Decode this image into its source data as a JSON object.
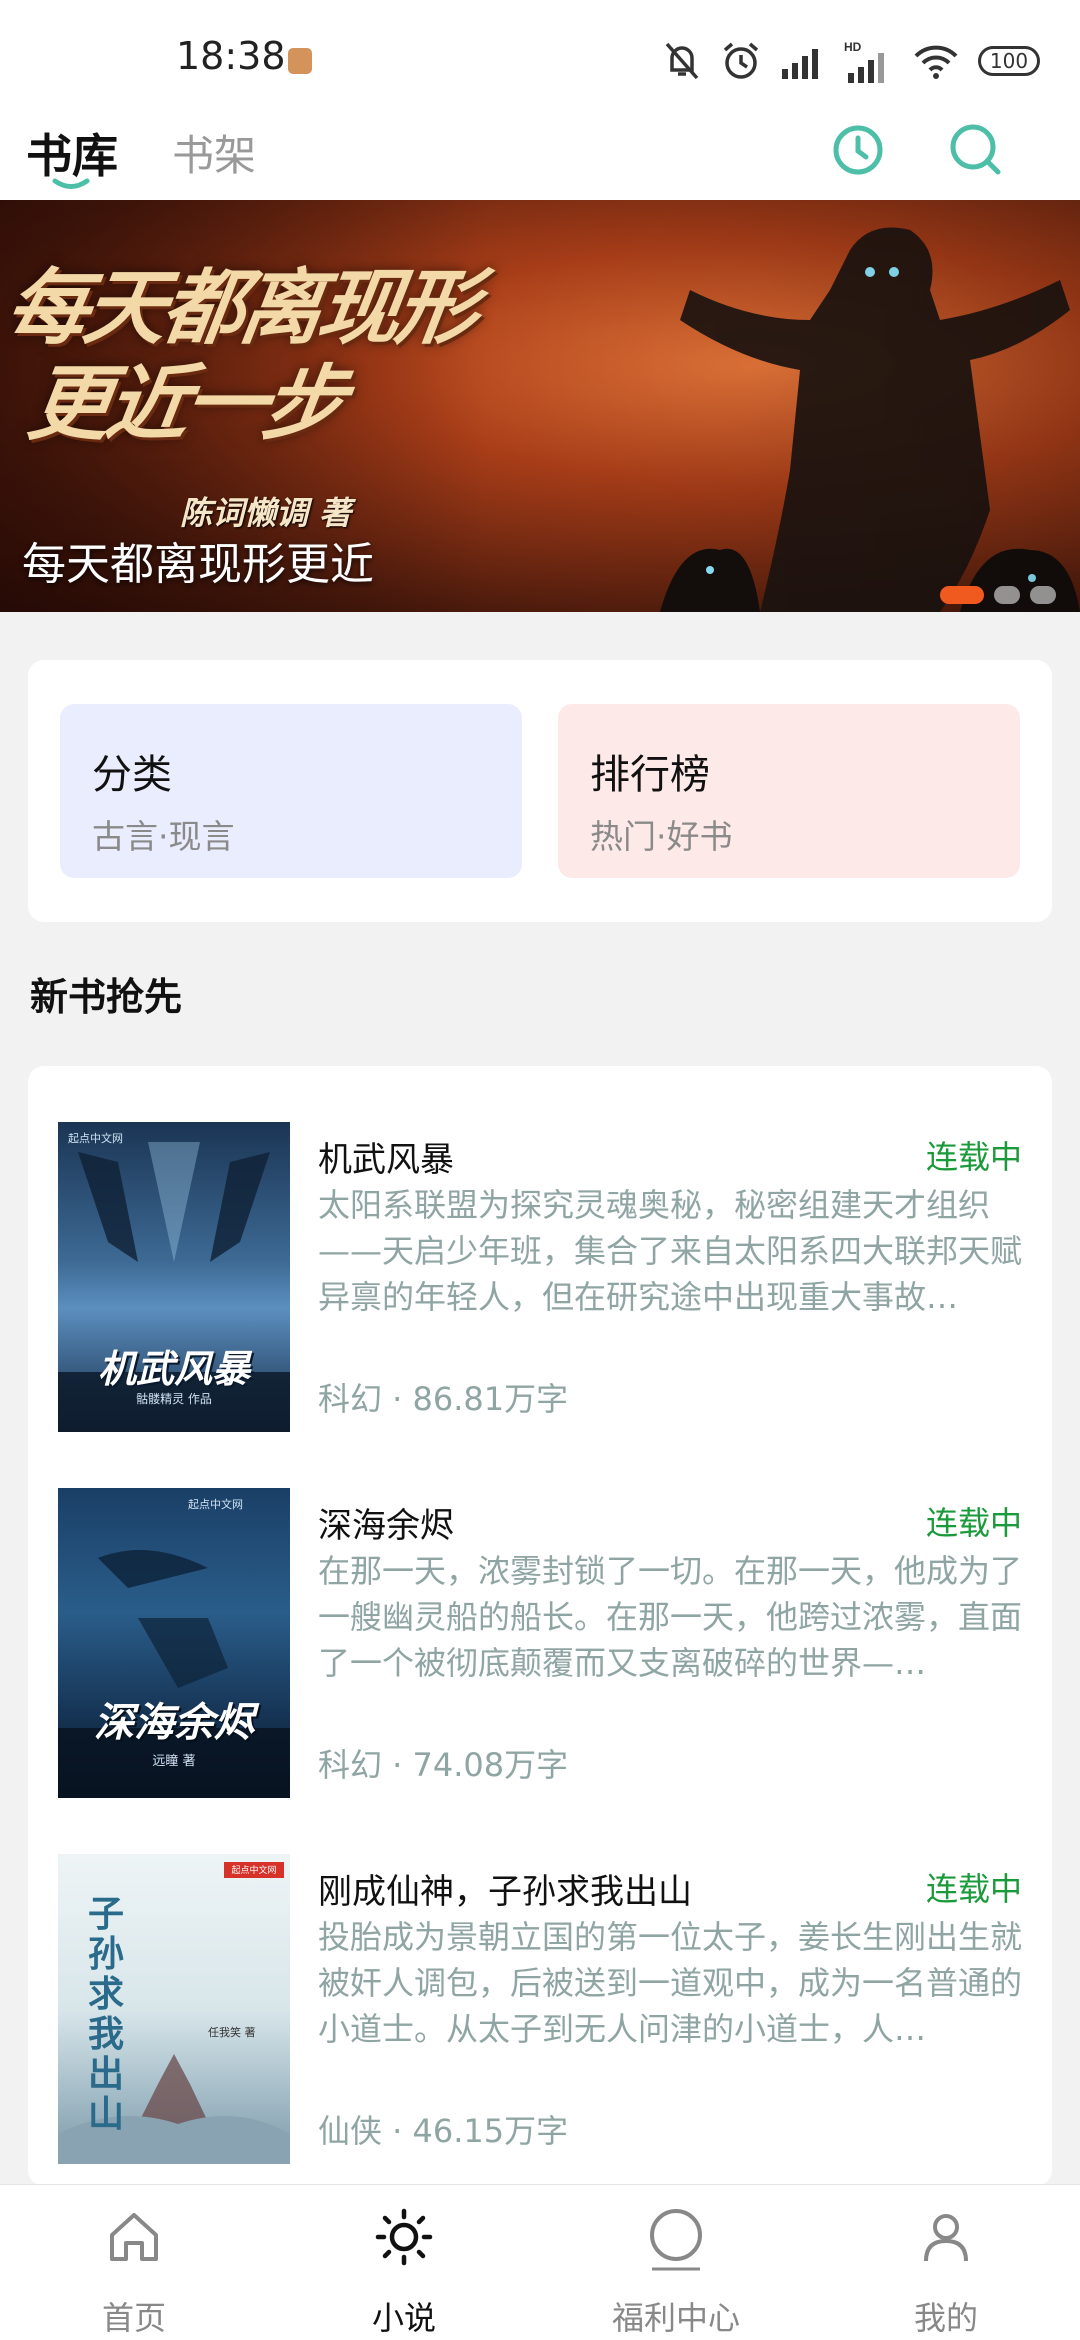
{
  "status_bar": {
    "time": "18:38",
    "network_label": "HD",
    "battery": "100"
  },
  "header": {
    "tab_active": "书库",
    "tab_inactive": "书架",
    "icons": [
      "history-icon",
      "search-icon"
    ]
  },
  "banner": {
    "art_title_line1": "每天都离现形",
    "art_title_line2": "更近一步",
    "art_author": "陈词懒调 著",
    "caption": "每天都离现形更近",
    "slide_count": 3,
    "active_slide": 0
  },
  "categories": [
    {
      "title": "分类",
      "subtitle": "古言·现言"
    },
    {
      "title": "排行榜",
      "subtitle": "热门·好书"
    }
  ],
  "section_title": "新书抢先",
  "books": [
    {
      "name": "机武风暴",
      "status": "连载中",
      "description": "太阳系联盟为探究灵魂奥秘，秘密组建天才组织——天启少年班，集合了来自太阳系四大联邦天赋异禀的年轻人，但在研究途中出现重大事故…",
      "meta": "科幻 · 86.81万字",
      "cover_title": "机武风暴",
      "cover_publisher": "起点中文网",
      "cover_author": "骷髅精灵 作品"
    },
    {
      "name": "深海余烬",
      "status": "连载中",
      "description": "在那一天，浓雾封锁了一切。在那一天，他成为了一艘幽灵船的船长。在那一天，他跨过浓雾，直面了一个被彻底颠覆而又支离破碎的世界—…",
      "meta": "科幻 · 74.08万字",
      "cover_title": "深海余烬",
      "cover_publisher": "起点中文网",
      "cover_author": "远瞳 著"
    },
    {
      "name": "刚成仙神，子孙求我出山",
      "status": "连载中",
      "description": "投胎成为景朝立国的第一位太子，姜长生刚出生就被奸人调包，后被送到一道观中，成为一名普通的小道士。从太子到无人问津的小道士，人…",
      "meta": "仙侠 · 46.15万字",
      "cover_title": "子孙求我出山",
      "cover_publisher": "起点中文网",
      "cover_author": "任我笑 著"
    }
  ],
  "bottom_nav": [
    {
      "label": "首页",
      "icon": "home-icon"
    },
    {
      "label": "小说",
      "icon": "sun-icon",
      "active": true
    },
    {
      "label": "福利中心",
      "icon": "circle-icon"
    },
    {
      "label": "我的",
      "icon": "user-icon"
    }
  ],
  "colors": {
    "accent": "#4dbfa8",
    "status_green": "#1a9a3a",
    "banner_dot_active": "#f05a1e"
  }
}
